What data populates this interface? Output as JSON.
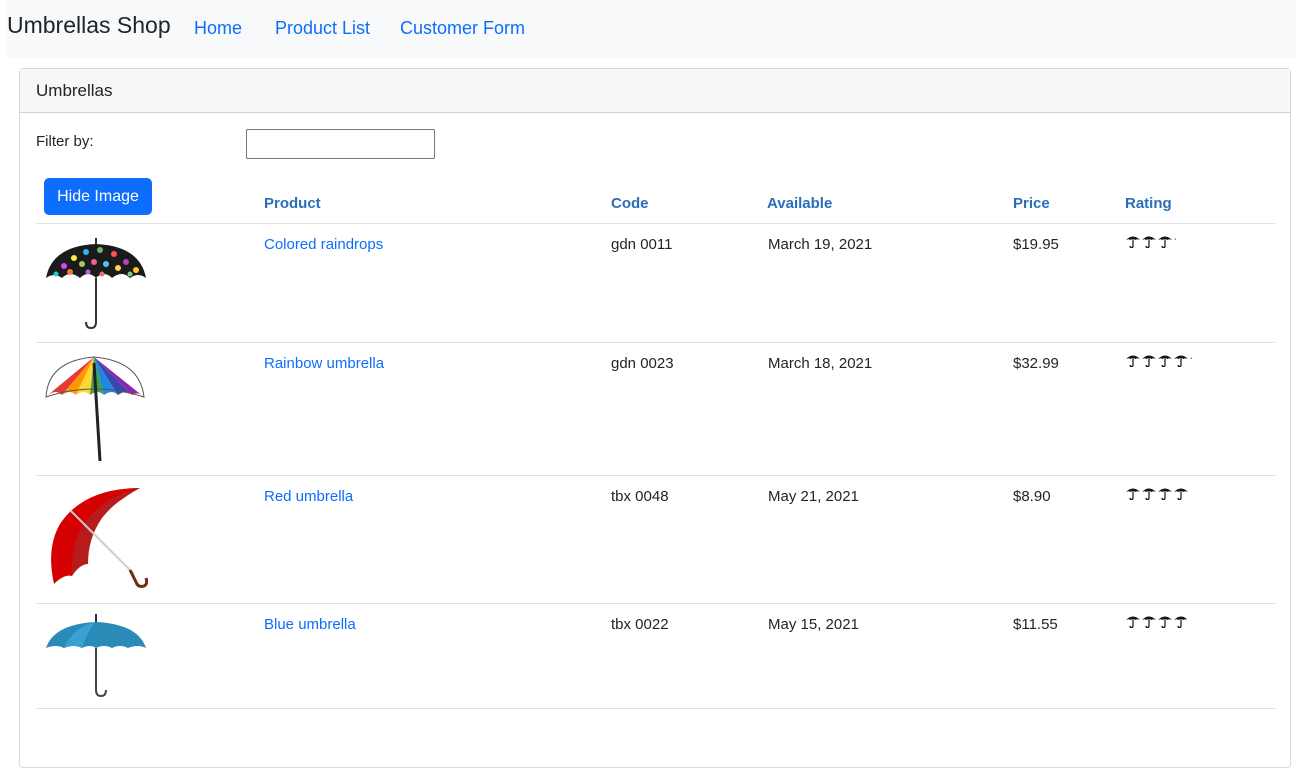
{
  "navbar": {
    "brand": "Umbrellas Shop",
    "links": [
      "Home",
      "Product List",
      "Customer Form"
    ]
  },
  "card": {
    "title": "Umbrellas",
    "filter_label": "Filter by:",
    "filter_value": "",
    "toggle_button": "Hide Image"
  },
  "table": {
    "headers": [
      "Product",
      "Code",
      "Available",
      "Price",
      "Rating"
    ],
    "rows": [
      {
        "name": "Colored raindrops",
        "code": "gdn 0011",
        "available": "March 19, 2021",
        "price": "$19.95",
        "rating": 3.2,
        "image": "colored-raindrops-umbrella"
      },
      {
        "name": "Rainbow umbrella",
        "code": "gdn 0023",
        "available": "March 18, 2021",
        "price": "$32.99",
        "rating": 4.2,
        "image": "rainbow-umbrella"
      },
      {
        "name": "Red umbrella",
        "code": "tbx 0048",
        "available": "May 21, 2021",
        "price": "$8.90",
        "rating": 4.0,
        "image": "red-umbrella"
      },
      {
        "name": "Blue umbrella",
        "code": "tbx 0022",
        "available": "May 15, 2021",
        "price": "$11.55",
        "rating": 3.9,
        "image": "blue-umbrella"
      }
    ]
  },
  "colors": {
    "primary": "#0d6efd",
    "header_text": "#2a6ebb",
    "navbar_bg": "#f8f9fa"
  }
}
